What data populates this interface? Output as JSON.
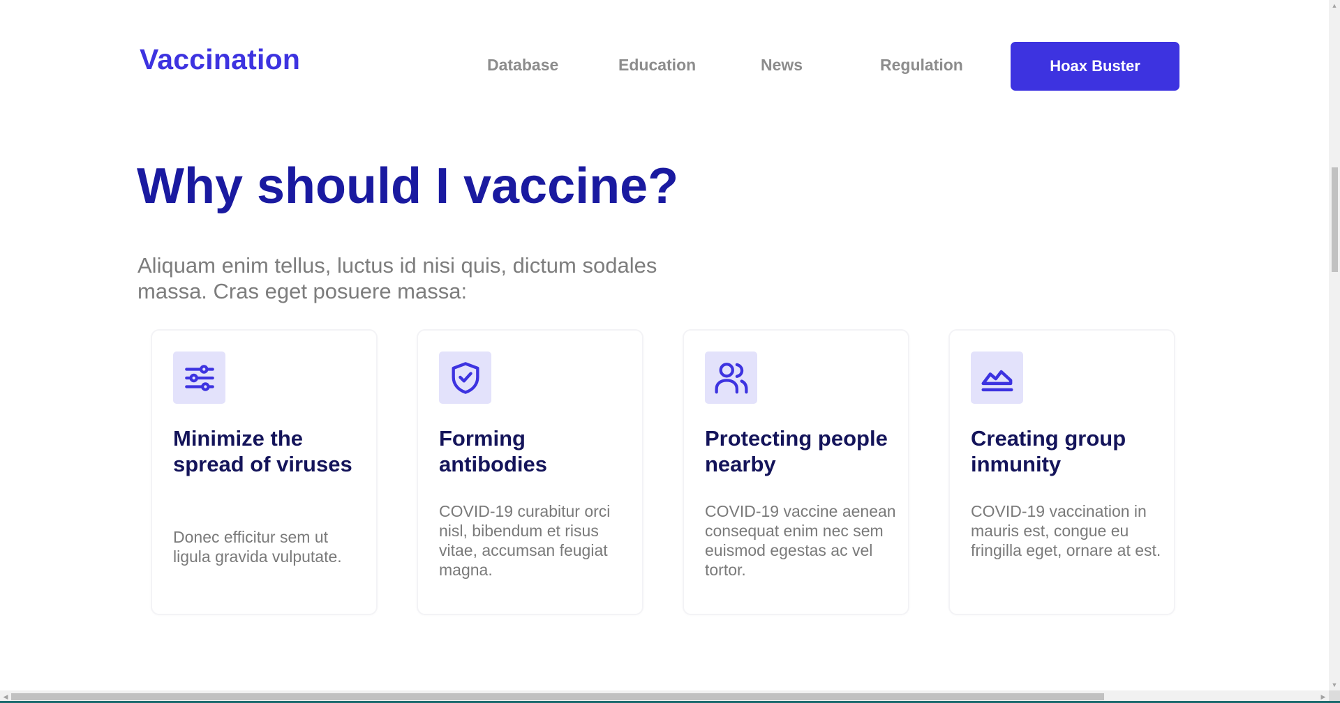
{
  "header": {
    "logo": "Vaccination",
    "nav": [
      {
        "label": "Database"
      },
      {
        "label": "Education"
      },
      {
        "label": "News"
      },
      {
        "label": "Regulation"
      }
    ],
    "cta_label": "Hoax Buster"
  },
  "hero": {
    "title": "Why should I vaccine?",
    "description": "Aliquam enim tellus, luctus id nisi quis, dictum sodales massa. Cras eget posuere massa:"
  },
  "cards": [
    {
      "icon": "sliders-icon",
      "title": "Minimize the spread of viruses",
      "text": "Donec efficitur sem ut ligula gravida vulputate."
    },
    {
      "icon": "shield-check-icon",
      "title": "Forming antibodies",
      "text": "COVID-19 curabitur orci nisl, bibendum et risus vitae, accumsan feugiat magna."
    },
    {
      "icon": "users-icon",
      "title": "Protecting people nearby",
      "text": "COVID-19 vaccine aenean consequat enim nec sem euismod egestas ac vel tortor."
    },
    {
      "icon": "area-chart-icon",
      "title": "Creating group inmunity",
      "text": "COVID-19 vaccination in mauris est, congue eu fringilla eget, ornare at est."
    }
  ],
  "colors": {
    "brand": "#3d33e0",
    "heading": "#1a1aa0",
    "card_title": "#14145a",
    "muted_text": "#7d7d7d",
    "icon_bg": "#e3e2fb"
  }
}
